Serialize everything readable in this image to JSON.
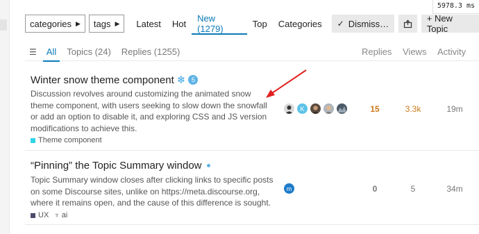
{
  "debug": {
    "timing": "5978.3 ms"
  },
  "navbar": {
    "categories_label": "categories",
    "tags_label": "tags",
    "items": [
      "Latest",
      "Hot",
      "New (1279)",
      "Top",
      "Categories"
    ],
    "dismiss_label": "Dismiss…",
    "new_topic_label": "+ New Topic"
  },
  "filters": {
    "tabs": [
      "All",
      "Topics (24)",
      "Replies (1255)"
    ],
    "columns": {
      "replies": "Replies",
      "views": "Views",
      "activity": "Activity"
    }
  },
  "topics": [
    {
      "title": "Winter snow theme component",
      "title_icon": "snowflake-icon",
      "badge": "5",
      "excerpt": "Discussion revolves around customizing the animated snow theme component, with users seeking to slow down the snowfall or add an option to disable it, and exploring CSS and JS version modifications to achieve this.",
      "category": "Theme component",
      "category_color": "#2fd4e8",
      "posters": [
        "",
        "K",
        "",
        "",
        ""
      ],
      "replies": "15",
      "views": "3.3k",
      "activity": "19m",
      "stat_color": "#cc7a1a"
    },
    {
      "title": "“Pinning” the Topic Summary window",
      "excerpt": "Topic Summary window closes after clicking links to specific posts on some Discourse sites, unlike on https://meta.discourse.org, where it remains open, and the cause of this difference is sought.",
      "category": "UX",
      "category_color": "#4b4b6b",
      "tag": "ai",
      "posters": [
        "m"
      ],
      "replies": "0",
      "views": "5",
      "activity": "34m",
      "stat_color": "#777777"
    }
  ],
  "colors": {
    "accent": "#0a7ab8",
    "annotation": "#e0201f"
  }
}
